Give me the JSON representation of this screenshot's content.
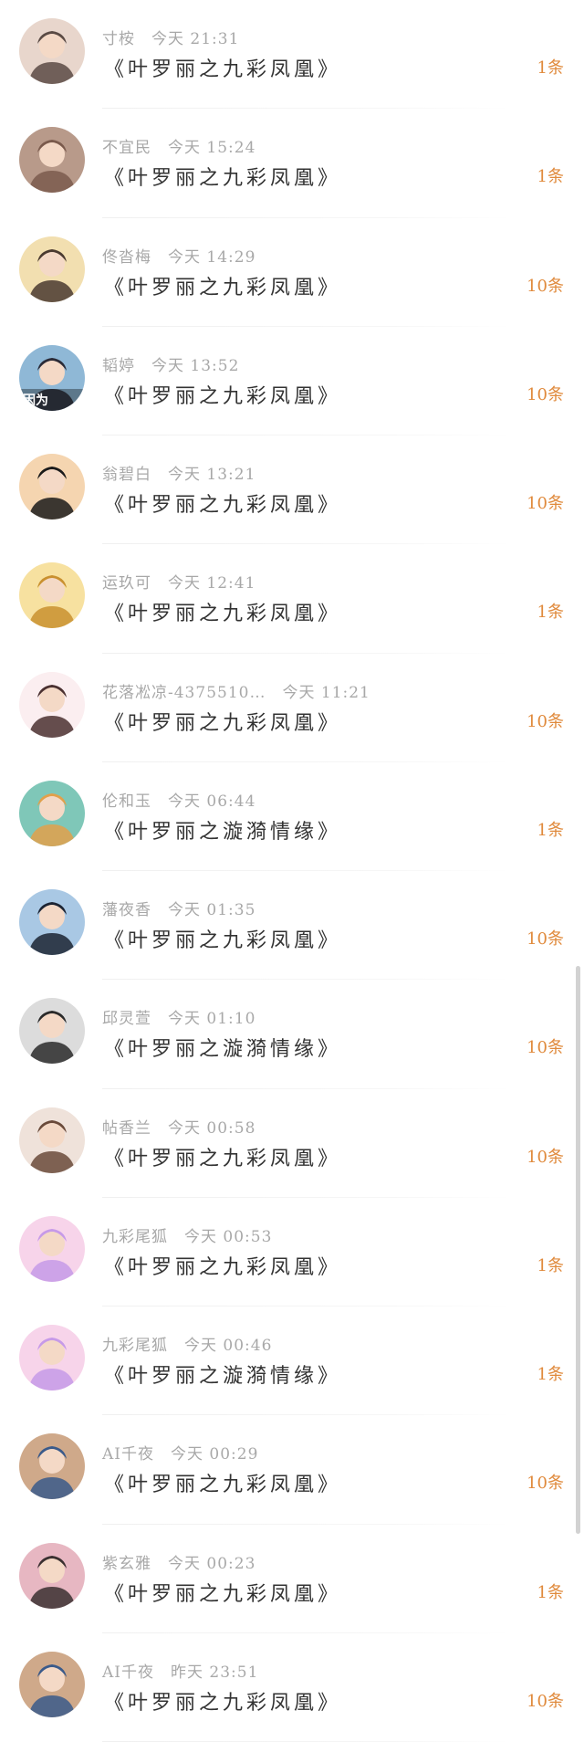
{
  "messages": [
    {
      "name": "寸桉",
      "time": "今天 21:31",
      "title": "《叶罗丽之九彩凤凰》",
      "count": "1条",
      "avatar_icon": "boy-avatar-icon",
      "colors": [
        "#e8d6cc",
        "#5a4a44"
      ]
    },
    {
      "name": "不宜民",
      "time": "今天 15:24",
      "title": "《叶罗丽之九彩凤凰》",
      "count": "1条",
      "avatar_icon": "room-avatar-icon",
      "colors": [
        "#b89a8a",
        "#7a5a4c"
      ]
    },
    {
      "name": "佟沓梅",
      "time": "今天 14:29",
      "title": "《叶罗丽之九彩凤凰》",
      "count": "10条",
      "avatar_icon": "cat-avatar-icon",
      "colors": [
        "#f2dfb0",
        "#4a3a30"
      ]
    },
    {
      "name": "韬婷",
      "time": "今天 13:52",
      "title": "《叶罗丽之九彩凤凰》",
      "count": "10条",
      "avatar_icon": "girl-avatar-icon",
      "colors": [
        "#8fb8d6",
        "#2a2a36"
      ],
      "overlay": "因为"
    },
    {
      "name": "翁碧白",
      "time": "今天 13:21",
      "title": "《叶罗丽之九彩凤凰》",
      "count": "10条",
      "avatar_icon": "cartoon-boy-avatar-icon",
      "colors": [
        "#f5d5b0",
        "#1a1a1a"
      ]
    },
    {
      "name": "运玖可",
      "time": "今天 12:41",
      "title": "《叶罗丽之九彩凤凰》",
      "count": "1条",
      "avatar_icon": "monkey-avatar-icon",
      "colors": [
        "#f7e1a0",
        "#c9902f"
      ]
    },
    {
      "name": "花落凇凉-4375510…",
      "time": "今天 11:21",
      "title": "《叶罗丽之九彩凤凰》",
      "count": "10条",
      "avatar_icon": "anime-girl-avatar-icon",
      "colors": [
        "#fbeef0",
        "#4a3030"
      ]
    },
    {
      "name": "伦和玉",
      "time": "今天 06:44",
      "title": "《叶罗丽之漩漪情缘》",
      "count": "1条",
      "avatar_icon": "anime-couple-avatar-icon",
      "colors": [
        "#7fc7b8",
        "#e2a04a"
      ]
    },
    {
      "name": "藩夜香",
      "time": "今天 01:35",
      "title": "《叶罗丽之九彩凤凰》",
      "count": "10条",
      "avatar_icon": "boy-avatar-icon",
      "colors": [
        "#a9c8e4",
        "#1c2433"
      ]
    },
    {
      "name": "邱灵萱",
      "time": "今天 01:10",
      "title": "《叶罗丽之漩漪情缘》",
      "count": "10条",
      "avatar_icon": "bw-portrait-avatar-icon",
      "colors": [
        "#dcdcdc",
        "#2a2a2a"
      ]
    },
    {
      "name": "帖香兰",
      "time": "今天 00:58",
      "title": "《叶罗丽之九彩凤凰》",
      "count": "10条",
      "avatar_icon": "girl-avatar-icon",
      "colors": [
        "#efe2da",
        "#6a4a3a"
      ]
    },
    {
      "name": "九彩尾狐",
      "time": "今天 00:53",
      "title": "《叶罗丽之九彩凤凰》",
      "count": "1条",
      "avatar_icon": "fox-avatar-icon",
      "colors": [
        "#f7d4ea",
        "#c69ae8"
      ]
    },
    {
      "name": "九彩尾狐",
      "time": "今天 00:46",
      "title": "《叶罗丽之漩漪情缘》",
      "count": "1条",
      "avatar_icon": "fox-avatar-icon",
      "colors": [
        "#f7d4ea",
        "#c69ae8"
      ]
    },
    {
      "name": "AI千夜",
      "time": "今天 00:29",
      "title": "《叶罗丽之九彩凤凰》",
      "count": "10条",
      "avatar_icon": "couple-avatar-icon",
      "colors": [
        "#cfa98a",
        "#3a5a8a"
      ]
    },
    {
      "name": "紫玄雅",
      "time": "今天 00:23",
      "title": "《叶罗丽之九彩凤凰》",
      "count": "1条",
      "avatar_icon": "two-girls-avatar-icon",
      "colors": [
        "#e7b7c2",
        "#3a3030"
      ]
    },
    {
      "name": "AI千夜",
      "time": "昨天 23:51",
      "title": "《叶罗丽之九彩凤凰》",
      "count": "10条",
      "avatar_icon": "couple-avatar-icon",
      "colors": [
        "#cfa98a",
        "#3a5a8a"
      ]
    }
  ]
}
